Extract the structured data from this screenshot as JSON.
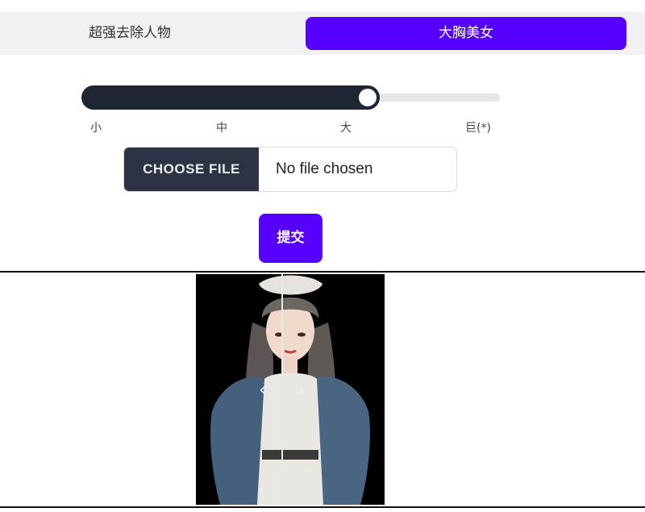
{
  "tabs": [
    {
      "label": "超强去除人物",
      "active": false
    },
    {
      "label": "大胸美女",
      "active": true
    }
  ],
  "size_slider": {
    "value_fraction": 0.66,
    "ticks": [
      "小",
      "中",
      "大",
      "巨(*)"
    ]
  },
  "file_input": {
    "button_label": "CHOOSE FILE",
    "status": "No file chosen"
  },
  "submit_label": "提交",
  "compare": {
    "left_arrow": "‹",
    "right_arrow": "›"
  },
  "colors": {
    "accent": "#5600ff",
    "slider_dark": "#1f2633",
    "file_button_bg": "#2c3444"
  }
}
